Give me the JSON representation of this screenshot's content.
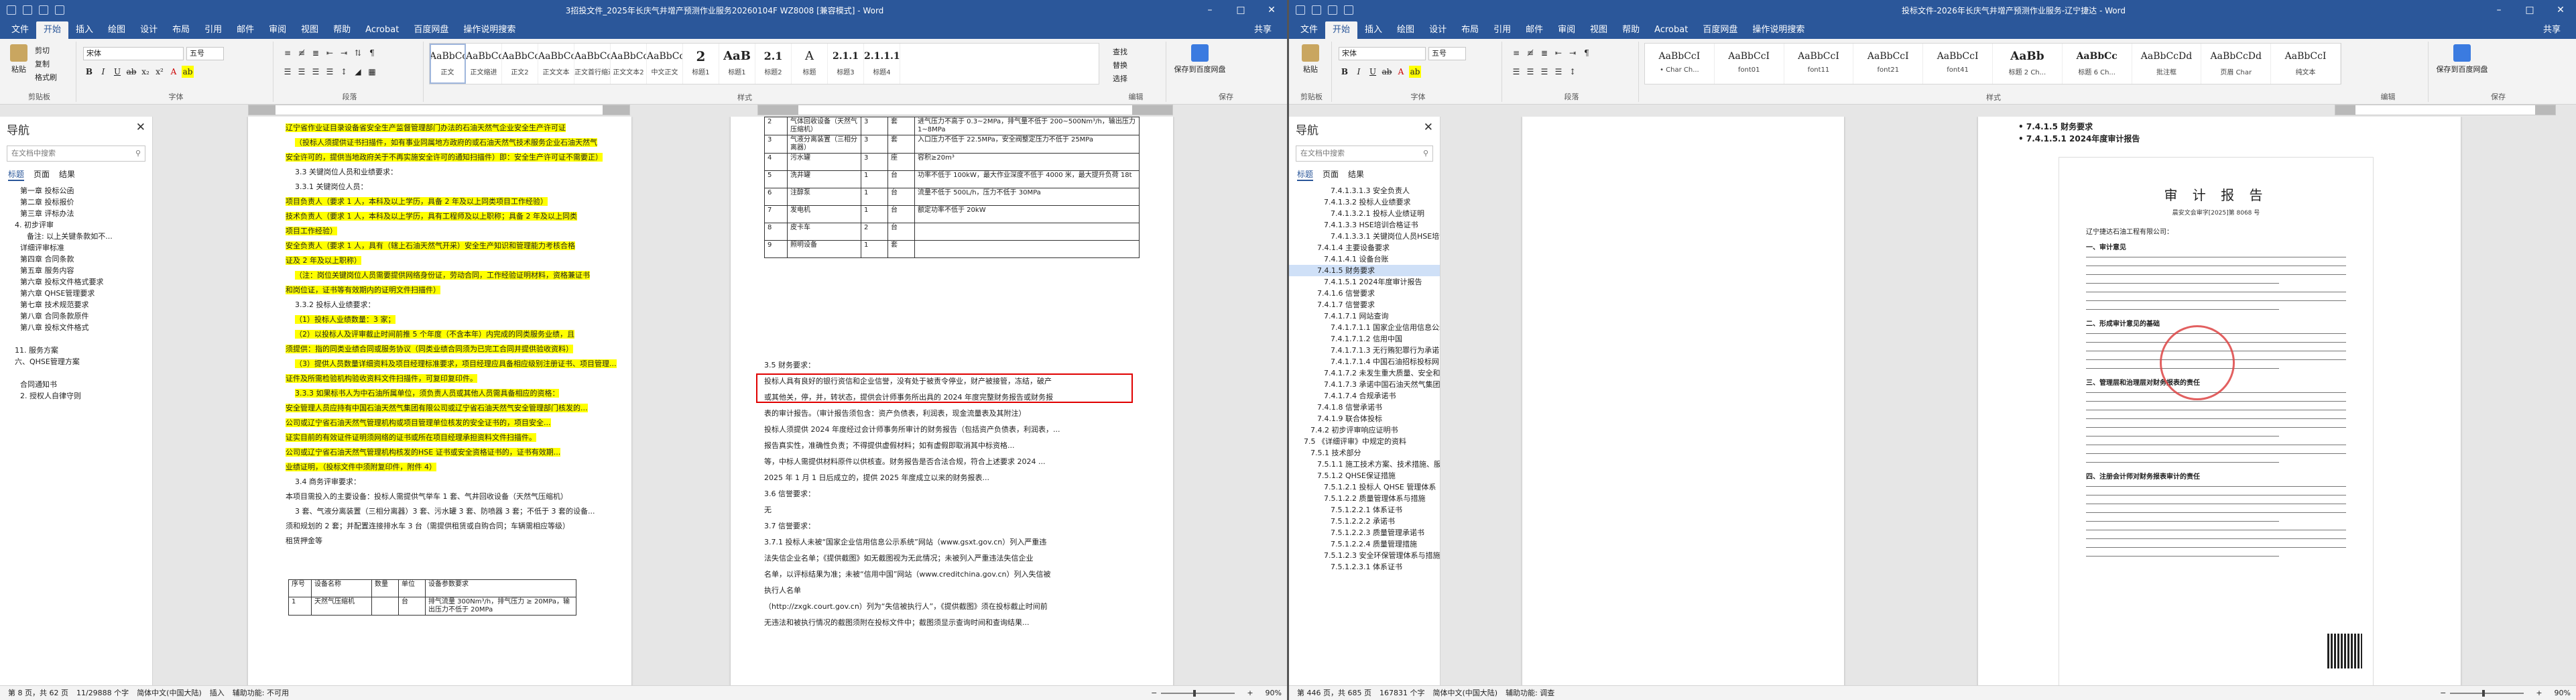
{
  "win1": {
    "title": "3招投文件_2025年长庆气井增产预测作业服务20260104F WZ8008 [兼容模式] - Word",
    "tabs": [
      "文件",
      "开始",
      "插入",
      "绘图",
      "设计",
      "布局",
      "引用",
      "邮件",
      "审阅",
      "视图",
      "帮助",
      "Acrobat",
      "百度网盘"
    ],
    "tellme": "操作说明搜索",
    "share": "共享",
    "ribbon": {
      "paste": "粘贴",
      "cut": "剪切",
      "copy": "复制",
      "format_painter": "格式刷",
      "clipboard": "剪贴板",
      "font_name": "宋体",
      "font_size": "五号",
      "font_group": "字体",
      "para_group": "段落",
      "styles_group": "样式",
      "edit_group": "编辑",
      "find": "查找",
      "replace": "替换",
      "select": "选择",
      "save_baidu": "保存到百度网盘",
      "save_group": "保存"
    },
    "styles": [
      {
        "pv": "AaBbCcDc",
        "nm": "正文"
      },
      {
        "pv": "AaBbCcI",
        "nm": "正文缩进"
      },
      {
        "pv": "AaBbCcDc",
        "nm": "正文2"
      },
      {
        "pv": "AaBbCc",
        "nm": "正文文本"
      },
      {
        "pv": "AaBbCcDc",
        "nm": "正文首行缩进"
      },
      {
        "pv": "AaBbCcD",
        "nm": "正文文本2"
      },
      {
        "pv": "AaBbCcI",
        "nm": "中文正文"
      },
      {
        "pv": "2",
        "nm": "标题1"
      },
      {
        "pv": "AaB",
        "nm": "标题1"
      },
      {
        "pv": "2.1",
        "nm": "标题2"
      },
      {
        "pv": "A",
        "nm": "标题"
      },
      {
        "pv": "2.1.1",
        "nm": "标题3"
      },
      {
        "pv": "2.1.1.1",
        "nm": "标题4"
      }
    ],
    "nav": {
      "title": "导航",
      "search": "在文档中搜索",
      "tabs": [
        "标题",
        "页面",
        "结果"
      ],
      "items": [
        "第一章  投标公函",
        "第二章  投标报价",
        "第三章  评标办法",
        "4. 初步评审",
        "备注: 以上关键条款如不...",
        "详细评审标准",
        "第四章  合同条款",
        "第五章  服务内容",
        "第六章  投标文件格式要求",
        "第六章  QHSE管理要求",
        "第七章  技术规范要求",
        "第八章  合同条款原件",
        "第八章  投标文件格式",
        "",
        "11. 服务方案",
        "六、QHSE管理方案",
        "",
        "合同通知书",
        "2. 授权人自律守则"
      ]
    },
    "doc_left": [
      "辽宁省作业证目录设备省安全生产监督管理部门办法的石油天然气企业安全生产许可证",
      "（投标人须提供证书扫描件，如有事业同属地方政府的或石油天然气技术服务企业石油天然气",
      "安全许可的，提供当地政府关于不再实施安全许可的通知扫描件）即：安全生产许可证不需要正）",
      "3.3  关键岗位人员和业绩要求：",
      "3.3.1  关键岗位人员：",
      "项目负责人（要求 1 人，本科及以上学历，具备 2 年及以上同类项目工作经验）",
      "技术负责人（要求 1 人，本科及以上学历，具有工程师及以上职称；具备 2 年及以上同类",
      "项目工作经验）",
      "安全负责人（要求 1 人，具有（辖上石油天然气开采）安全生产知识和管理能力考核合格",
      "证及 2 年及以上职称）",
      "（注：岗位关键岗位人员需要提供网络身份证，劳动合同，工作经验证明材料，资格兼证书",
      "和岗位证，证书等有效期内的证明文件扫描件）",
      "3.3.2  投标人业绩要求：",
      "（1）投标人业绩数量：3 家；",
      "（2）以投标人及评审截止时间前推 5 个年度（不含本年）内完成的同类服务业绩，且",
      "须提供：指的同类业绩合同或服务协议（同类业绩合同须为已完工合同并提供验收资料）",
      "（3）提供人员数量详细资料及项目经理标准要求，项目经理应具备相应级别注册证书、项目管理...",
      "证件及所需检验机构验收资料文件扫描件，可复印复印件。",
      "3.3.3  如果标书人为中石油所属单位，须负责人员或其他人员需具备相应的资格：",
      "安全管理人员应持有中国石油天然气集团有限公司或辽宁省石油天然气安全管理部门核发的...",
      "公司或辽宁省石油天然气管理机构或项目管理单位核发的安全证书的，项目安全...",
      "证实目前的有效证件证明须网络的证书或所在项目经理承担资料文件扫描件。",
      "公司或辽宁省石油天然气管理机构核发的HSE 证书或安全资格证书的，证书有效期...",
      "业绩证明，（投标文件中须附复印件，附件 4）",
      "3.4  商务评审要求：",
      "本项目需投入的主要设备：投标人需提供气举车 1 套、气井回收设备（天然气压缩机）",
      "3 套、气液分离装置（三相分离器）3 套、污水罐 3 套、防喷器 3 套；不低于 3 套的设备...",
      "须和规划的 2 套；并配置连接排水车 3 台（需提供租赁或自购合同；车辆需相应等级）",
      "租赁押金等"
    ],
    "table_small": {
      "headers": [
        "序号",
        "设备名称",
        "数量",
        "单位",
        "设备参数要求"
      ],
      "row": [
        "1",
        "天然气压缩机",
        "",
        "台",
        "排气流量 300Nm³/h，排气压力 ≥ 20MPa，输出压力不低于 20MPa"
      ]
    },
    "doc_mid_table": [
      [
        "2",
        "气体回收设备（天然气压缩机）",
        "3",
        "套",
        "进气压力不高于 0.3~2MPa，排气量不低于 200~500Nm³/h，输出压力 1~8MPa"
      ],
      [
        "3",
        "气液分离装置（三相分离器）",
        "3",
        "套",
        "入口压力不低于 22.5MPa，安全阀整定压力不低于 25MPa"
      ],
      [
        "4",
        "污水罐",
        "3",
        "座",
        "容积≥20m³"
      ],
      [
        "5",
        "洗井罐",
        "1",
        "台",
        "功率不低于 100kW，最大作业深度不低于 4000 米，最大提升负荷 18t"
      ],
      [
        "6",
        "注醇泵",
        "1",
        "台",
        "流量不低于 500L/h，压力不低于 30MPa"
      ],
      [
        "7",
        "发电机",
        "1",
        "台",
        "额定功率不低于 20kW"
      ],
      [
        "8",
        "皮卡车",
        "2",
        "台",
        ""
      ],
      [
        "9",
        "照明设备",
        "1",
        "套",
        ""
      ]
    ],
    "doc_mid": [
      "3.5  财务要求：",
      "投标人具有良好的银行资信和企业信誉，没有处于被责令停业，财产被接管，冻结，破产",
      "或其他关，停，并，转状态，提供会计师事务所出具的 2024 年度完整财务报告或财务报",
      "表的审计报告。（审计报告须包含：资产负债表，利润表，现金流量表及其附注）",
      "投标人须提供 2024 年度经过会计师事务所审计的财务报告（包括资产负债表，利润表，...",
      "报告真实性，准确性负责；不得提供虚假材料；如有虚假即取消其中标资格...",
      "等，中标人需提供材料原件以供核查。财务报告是否合法合规，符合上述要求 2024 ...",
      "2025 年 1 月 1 日后成立的，提供 2025 年度成立以来的财务报表...",
      "3.6  信誉要求：",
      "无",
      "3.7  信誉要求：",
      "3.7.1  投标人未被“国家企业信用信息公示系统”网站（www.gsxt.gov.cn）列入严重违",
      "法失信企业名单；《提供截图》如无截图视为无此情况；未被列入严重违法失信企业",
      "名单，以评标结果为准；未被“信用中国”网站（www.creditchina.gov.cn）列入失信被",
      "执行人名单",
      "（http://zxgk.court.gov.cn）列为“失信被执行人”，《提供截图》须在投标截止时间前",
      "无违法和被执行情况的截图须附在投标文件中；截图须显示查询时间和查询结果..."
    ],
    "status": {
      "page": "第 8 页，共 62 页",
      "words": "11/29888 个字",
      "lang": "简体中文(中国大陆)",
      "insert": "插入",
      "focus": "辅助功能: 不可用",
      "zoom": "90%"
    }
  },
  "win2": {
    "title": "投标文件-2026年长庆气井增产预测作业服务-辽宁捷达 - Word",
    "tabs": [
      "文件",
      "开始",
      "插入",
      "绘图",
      "设计",
      "布局",
      "引用",
      "邮件",
      "审阅",
      "视图",
      "帮助",
      "Acrobat",
      "百度网盘"
    ],
    "tellme": "操作说明搜索",
    "share": "共享",
    "ribbon": {
      "paste": "粘贴",
      "font_name": "宋体",
      "font_size": "五号",
      "font_group": "字体",
      "para_group": "段落",
      "styles_group": "样式",
      "edit_group": "编辑",
      "save_baidu": "保存到百度网盘",
      "save_group": "保存",
      "clipboard": "剪贴板"
    },
    "styles": [
      {
        "pv": "AaBbCcI",
        "nm": "• Char Ch..."
      },
      {
        "pv": "AaBbCcI",
        "nm": "font01"
      },
      {
        "pv": "AaBbCcI",
        "nm": "font11"
      },
      {
        "pv": "AaBbCcI",
        "nm": "font21"
      },
      {
        "pv": "AaBbCcI",
        "nm": "font41"
      },
      {
        "pv": "AaBb",
        "nm": "标题 2 Ch..."
      },
      {
        "pv": "AaBbCc",
        "nm": "标题 6 Ch..."
      },
      {
        "pv": "AaBbCcDd",
        "nm": "批注框"
      },
      {
        "pv": "AaBbCcDd",
        "nm": "页眉 Char"
      },
      {
        "pv": "AaBbCcI",
        "nm": "纯文本"
      }
    ],
    "nav": {
      "title": "导航",
      "search": "在文档中搜索",
      "tabs": [
        "标题",
        "页面",
        "结果"
      ],
      "items": [
        "7.4.1.3.1.3  安全负责人",
        "7.4.1.3.2  投标人业绩要求",
        "7.4.1.3.2.1  投标人业绩证明",
        "7.4.1.3.3  HSE培训合格证书",
        "7.4.1.3.3.1  关键岗位人员HSE培训...",
        "7.4.1.4  主要设备要求",
        "7.4.1.4.1  设备台账",
        "7.4.1.5  财务要求",
        "7.4.1.5.1  2024年度审计报告",
        "7.4.1.6  信誉要求",
        "7.4.1.7  信誉要求",
        "7.4.1.7.1  网站查询",
        "7.4.1.7.1.1  国家企业信用信息公示...",
        "7.4.1.7.1.2  信用中国",
        "7.4.1.7.1.3  无行贿犯罪行为承诺",
        "7.4.1.7.1.4  中国石油招标投标网",
        "7.4.1.7.2  未发生重大质量、安全和环境...",
        "7.4.1.7.3  承诺中国石油天然气集团有限...",
        "7.4.1.7.4  合规承诺书",
        "7.4.1.8  信誉承诺书",
        "7.4.1.9  联合体投标",
        "7.4.2  初步评审响应证明书",
        "7.5  《详细评审》中规定的资料",
        "7.5.1  技术部分",
        "7.5.1.1  施工技术方案、技术措施、服务方案",
        "7.5.1.2  QHSE保证措施",
        "7.5.1.2.1  投标人 QHSE 管理体系",
        "7.5.1.2.2  质量管理体系与措施",
        "7.5.1.2.2.1  体系证书",
        "7.5.1.2.2.2  承诺书",
        "7.5.1.2.2.3  质量管理承诺书",
        "7.5.1.2.2.4  质量管理措施",
        "7.5.1.2.3  安全环保管理体系与措施",
        "7.5.1.2.3.1  体系证书"
      ]
    },
    "doc_right_heads": [
      "• 7.4.1.5  财务要求",
      "• 7.4.1.5.1  2024年度审计报告"
    ],
    "audit": {
      "title": "审 计 报 告",
      "no": "晨安文会审字[2025]第 8068 号",
      "to": "辽宁捷达石油工程有限公司：",
      "sec1": "一、审计意见",
      "sec2": "二、形成审计意见的基础",
      "sec3": "三、管理层和治理层对财务报表的责任",
      "sec4": "四、注册会计师对财务报表审计的责任"
    },
    "status": {
      "page": "第 446 页，共 685 页",
      "words": "167831 个字",
      "lang": "简体中文(中国大陆)",
      "focus": "辅助功能: 调查",
      "zoom": "90%"
    }
  }
}
